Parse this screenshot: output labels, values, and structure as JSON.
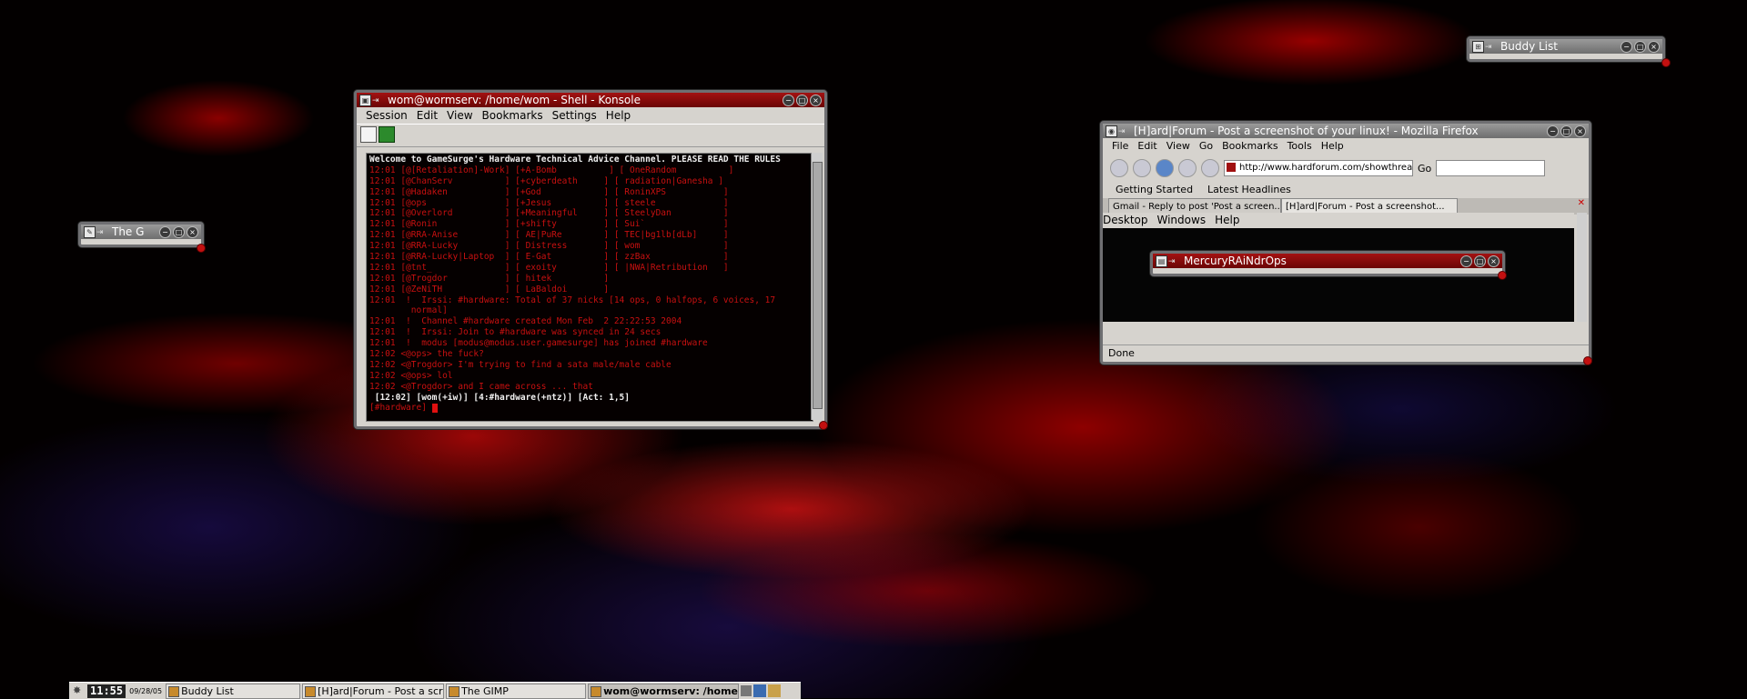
{
  "konsole": {
    "title": "wom@wormserv: /home/wom - Shell - Konsole",
    "menu": [
      "Session",
      "Edit",
      "View",
      "Bookmarks",
      "Settings",
      "Help"
    ],
    "terminal_lines": [
      {
        "text": "Welcome to GameSurge's Hardware Technical Advice Channel. PLEASE READ THE RULES",
        "style": "hl"
      },
      {
        "text": "12:01 [@[Retaliation]-Work] [+A-Bomb          ] [ OneRandom          ]",
        "style": ""
      },
      {
        "text": "12:01 [@ChanServ          ] [+cyberdeath     ] [ radiation|Ganesha ]",
        "style": ""
      },
      {
        "text": "12:01 [@Hadaken           ] [+God            ] [ RoninXPS           ]",
        "style": ""
      },
      {
        "text": "12:01 [@ops               ] [+Jesus          ] [ steele             ]",
        "style": ""
      },
      {
        "text": "12:01 [@Overlord          ] [+Meaningful     ] [ SteelyDan          ]",
        "style": ""
      },
      {
        "text": "12:01 [@Ronin             ] [+shifty         ] [ Sui`               ]",
        "style": ""
      },
      {
        "text": "12:01 [@RRA-Anise         ] [ AE|PuRe        ] [ TEC|bg1lb[dLb]     ]",
        "style": ""
      },
      {
        "text": "12:01 [@RRA-Lucky         ] [ Distress       ] [ wom                ]",
        "style": ""
      },
      {
        "text": "12:01 [@RRA-Lucky|Laptop  ] [ E-Gat          ] [ zzBax              ]",
        "style": ""
      },
      {
        "text": "12:01 [@tnt_              ] [ exoity         ] [ |NWA|Retribution   ]",
        "style": ""
      },
      {
        "text": "12:01 [@Trogdor           ] [ hitek          ]",
        "style": ""
      },
      {
        "text": "12:01 [@ZeNiTH            ] [ LaBaldoi       ]",
        "style": ""
      },
      {
        "text": "12:01  !  Irssi: #hardware: Total of 37 nicks [14 ops, 0 halfops, 6 voices, 17",
        "style": ""
      },
      {
        "text": "        normal]",
        "style": ""
      },
      {
        "text": "12:01  !  Channel #hardware created Mon Feb  2 22:22:53 2004",
        "style": ""
      },
      {
        "text": "12:01  !  Irssi: Join to #hardware was synced in 24 secs",
        "style": ""
      },
      {
        "text": "12:01  !  modus [modus@modus.user.gamesurge] has joined #hardware",
        "style": ""
      },
      {
        "text": "12:02 <@ops> the fuck?",
        "style": ""
      },
      {
        "text": "12:02 <@Trogdor> I'm trying to find a sata male/male cable",
        "style": ""
      },
      {
        "text": "12:02 <@ops> lol",
        "style": ""
      },
      {
        "text": "12:02 <@Trogdor> and I came across ... that",
        "style": ""
      },
      {
        "text": " [12:02] [wom(+iw)] [4:#hardware(+ntz)] [Act: 1,5]",
        "style": "hl"
      },
      {
        "text": "[#hardware] ",
        "style": "prompt"
      }
    ]
  },
  "firefox": {
    "title": "[H]ard|Forum - Post a screenshot of your linux! - Mozilla Firefox",
    "menu": [
      "File",
      "Edit",
      "View",
      "Go",
      "Bookmarks",
      "Tools",
      "Help"
    ],
    "url": "http://www.hardforum.com/showthread",
    "go_label": "Go",
    "bookmarks": [
      "Getting Started",
      "Latest Headlines"
    ],
    "tabs": [
      "Gmail - Reply to post 'Post a screen...",
      "[H]ard|Forum - Post a screenshot..."
    ],
    "inner_menu": [
      "Desktop",
      "Windows",
      "Help"
    ],
    "status": "Done"
  },
  "mercury": {
    "title": "MercuryRAiNdrOps"
  },
  "buddylist": {
    "title": "Buddy List"
  },
  "gimp": {
    "title": "The G"
  },
  "taskbar": {
    "clock": "11:55",
    "date": "09/28/05",
    "items": [
      "Buddy List",
      "[H]ard|Forum - Post a scre",
      "The GIMP",
      "wom@wormserv: /home"
    ]
  },
  "colors": {
    "titlebar_active": "#8a0b0b",
    "terminal_text": "#c81010",
    "terminal_bg": "#050000"
  }
}
